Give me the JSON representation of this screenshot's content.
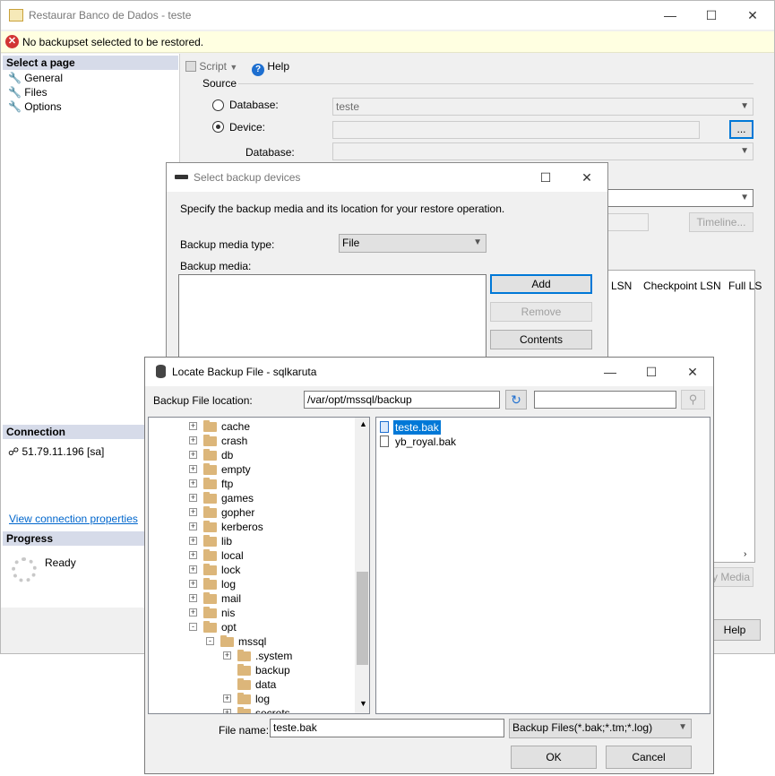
{
  "main": {
    "title": "Restaurar Banco de Dados - teste",
    "error": "No backupset selected to be restored.",
    "select_page": "Select a page",
    "pages": [
      "General",
      "Files",
      "Options"
    ],
    "toolbar": {
      "script": "Script",
      "help": "Help"
    },
    "source": "Source",
    "database_radio": "Database:",
    "database_value": "teste",
    "device_radio": "Device:",
    "browse": "...",
    "device_database": "Database:",
    "timeline": "Timeline...",
    "grid_headers": [
      "LSN",
      "Checkpoint LSN",
      "Full LS"
    ],
    "verify_media": "y Media",
    "help_button": "Help",
    "connection": "Connection",
    "server": "51.79.11.196 [sa]",
    "view_conn": "View connection properties",
    "progress": "Progress",
    "ready": "Ready"
  },
  "select_devices": {
    "title": "Select backup devices",
    "instruction": "Specify the backup media and its location for your restore operation.",
    "media_type_label": "Backup media type:",
    "media_type": "File",
    "media_label": "Backup media:",
    "add": "Add",
    "remove": "Remove",
    "contents": "Contents"
  },
  "locate": {
    "title": "Locate Backup File - sqlkaruta",
    "location_label": "Backup File location:",
    "location": "/var/opt/mssql/backup",
    "search_value": "",
    "tree": [
      {
        "label": "cache",
        "expander": "+"
      },
      {
        "label": "crash",
        "expander": "+"
      },
      {
        "label": "db",
        "expander": "+"
      },
      {
        "label": "empty",
        "expander": "+"
      },
      {
        "label": "ftp",
        "expander": "+"
      },
      {
        "label": "games",
        "expander": "+"
      },
      {
        "label": "gopher",
        "expander": "+"
      },
      {
        "label": "kerberos",
        "expander": "+"
      },
      {
        "label": "lib",
        "expander": "+"
      },
      {
        "label": "local",
        "expander": "+"
      },
      {
        "label": "lock",
        "expander": "+"
      },
      {
        "label": "log",
        "expander": "+"
      },
      {
        "label": "mail",
        "expander": "+"
      },
      {
        "label": "nis",
        "expander": "+"
      },
      {
        "label": "opt",
        "expander": "-"
      },
      {
        "label": "mssql",
        "expander": "-"
      },
      {
        "label": ".system",
        "expander": "+"
      },
      {
        "label": "backup",
        "expander": ""
      },
      {
        "label": "data",
        "expander": ""
      },
      {
        "label": "log",
        "expander": "+"
      },
      {
        "label": "secrets",
        "expander": "+"
      }
    ],
    "files": [
      "teste.bak",
      "yb_royal.bak"
    ],
    "file_name_label": "File name:",
    "file_name": "teste.bak",
    "file_type": "Backup Files(*.bak;*.tm;*.log)",
    "ok": "OK",
    "cancel": "Cancel"
  },
  "colors": {
    "error_bg": "#ffffe1",
    "section_bg": "#d6dbe9",
    "selection": "#0078d7",
    "link": "#0066cc",
    "folder": "#dcb67a"
  }
}
